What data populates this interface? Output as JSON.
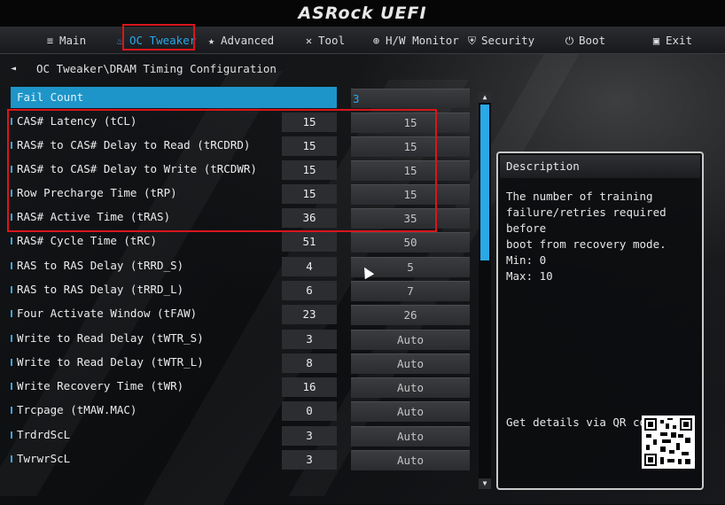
{
  "app": {
    "logo": "ASRock UEFI"
  },
  "menu": [
    {
      "label": "Main",
      "icon": "≡"
    },
    {
      "label": "OC Tweaker",
      "icon": "♨"
    },
    {
      "label": "Advanced",
      "icon": "★"
    },
    {
      "label": "Tool",
      "icon": "✕"
    },
    {
      "label": "H/W Monitor",
      "icon": "⊕"
    },
    {
      "label": "Security",
      "icon": "⛨"
    },
    {
      "label": "Boot",
      "icon": "⏻"
    },
    {
      "label": "Exit",
      "icon": "▣"
    }
  ],
  "active_menu": "OC Tweaker",
  "breadcrumb": {
    "arrow": "◄",
    "text": "OC Tweaker\\DRAM Timing Configuration"
  },
  "rows": [
    {
      "label": "Fail Count",
      "current": "",
      "value": "3"
    },
    {
      "label": "CAS# Latency (tCL)",
      "current": "15",
      "value": "15"
    },
    {
      "label": "RAS# to CAS# Delay to Read  (tRCDRD)",
      "current": "15",
      "value": "15"
    },
    {
      "label": "RAS# to CAS# Delay to Write (tRCDWR)",
      "current": "15",
      "value": "15"
    },
    {
      "label": "Row Precharge Time (tRP)",
      "current": "15",
      "value": "15"
    },
    {
      "label": "RAS# Active Time (tRAS)",
      "current": "36",
      "value": "35"
    },
    {
      "label": "RAS# Cycle Time (tRC)",
      "current": "51",
      "value": "50"
    },
    {
      "label": "RAS to RAS Delay (tRRD_S)",
      "current": "4",
      "value": "5"
    },
    {
      "label": "RAS to RAS Delay (tRRD_L)",
      "current": "6",
      "value": "7"
    },
    {
      "label": "Four Activate Window (tFAW)",
      "current": "23",
      "value": "26"
    },
    {
      "label": "Write to Read Delay (tWTR_S)",
      "current": "3",
      "value": "Auto"
    },
    {
      "label": "Write to Read Delay (tWTR_L)",
      "current": "8",
      "value": "Auto"
    },
    {
      "label": "Write Recovery Time (tWR)",
      "current": "16",
      "value": "Auto"
    },
    {
      "label": "Trcpage (tMAW.MAC)",
      "current": "0",
      "value": "Auto"
    },
    {
      "label": "TrdrdScL",
      "current": "3",
      "value": "Auto"
    },
    {
      "label": "TwrwrScL",
      "current": "3",
      "value": "Auto"
    }
  ],
  "scrollbar": {
    "up": "▲",
    "down": "▼"
  },
  "description": {
    "title": "Description",
    "body": "The number of training\nfailure/retries required before\nboot from recovery mode.",
    "range": "Min: 0\nMax: 10",
    "qr_text": "Get details via QR code"
  },
  "colors": {
    "accent": "#2aa8e8",
    "highlight_box": "#d8161b"
  }
}
